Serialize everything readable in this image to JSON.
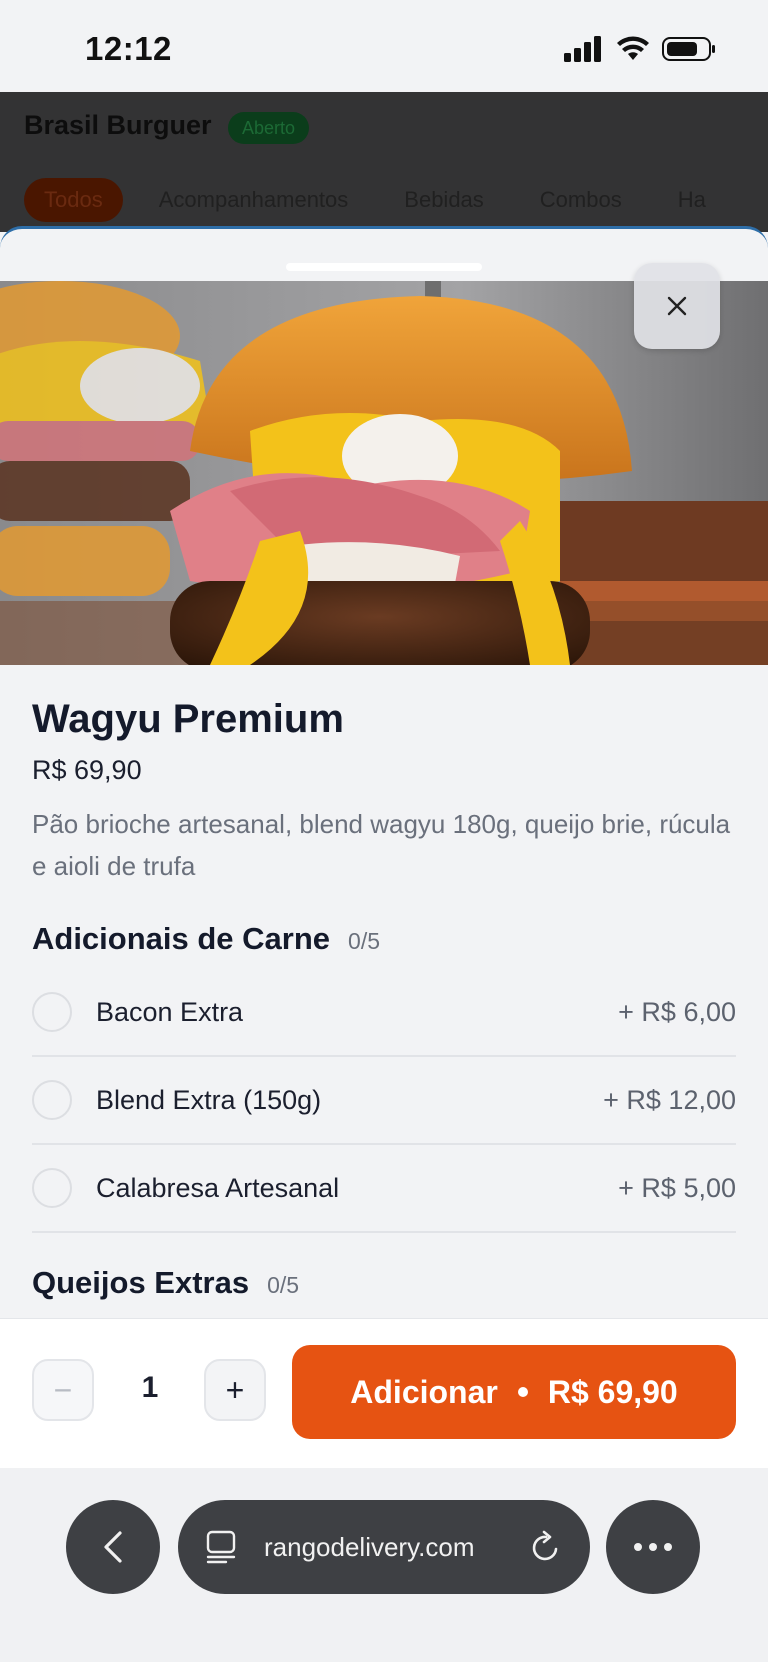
{
  "status_bar": {
    "time": "12:12",
    "icons": [
      "signal-icon",
      "wifi-icon",
      "battery-icon"
    ]
  },
  "background_app": {
    "store_name": "Brasil Burguer",
    "status_badge": "Aberto",
    "categories": [
      "Todos",
      "Acompanhamentos",
      "Bebidas",
      "Combos",
      "Ha"
    ]
  },
  "product": {
    "title": "Wagyu Premium",
    "price": "R$ 69,90",
    "description": "Pão brioche artesanal, blend wagyu 180g, queijo brie, rúcula e aioli de trufa",
    "image_icon": "burger-photo",
    "close_icon": "close-icon"
  },
  "sections": [
    {
      "title": "Adicionais de Carne",
      "count": "0/5",
      "options": [
        {
          "name": "Bacon Extra",
          "price": "+ R$ 6,00"
        },
        {
          "name": "Blend Extra (150g)",
          "price": "+ R$ 12,00"
        },
        {
          "name": "Calabresa Artesanal",
          "price": "+ R$ 5,00"
        }
      ]
    },
    {
      "title": "Queijos Extras",
      "count": "0/5"
    }
  ],
  "footer": {
    "minus_label": "−",
    "quantity": "1",
    "plus_label": "+",
    "add_label": "Adicionar",
    "add_price": "R$ 69,90"
  },
  "browser": {
    "url": "rangodelivery.com"
  },
  "colors": {
    "accent": "#e65312",
    "sheet_border": "#2e6ea8",
    "browser_pill": "#3e4044"
  }
}
